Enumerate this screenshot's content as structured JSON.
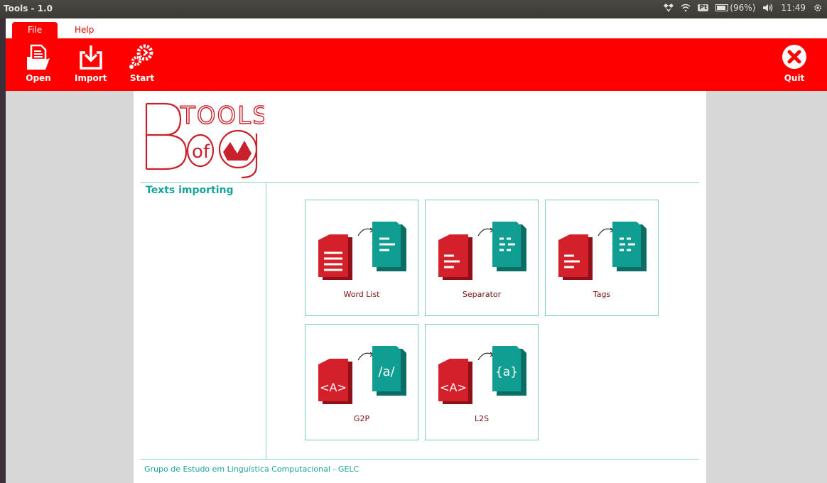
{
  "system_bar": {
    "window_title": "Tools - 1.0",
    "keyboard_layout": "Pt",
    "battery": "(96%)",
    "time": "11:49"
  },
  "menu": {
    "tabs": [
      {
        "label": "File",
        "active": true
      },
      {
        "label": "Help",
        "active": false
      }
    ]
  },
  "toolbar": {
    "open_label": "Open",
    "import_label": "Import",
    "start_label": "Start",
    "quit_label": "Quit"
  },
  "logo": {
    "line1": "TOOLS",
    "line2": "of",
    "line3": "Bag"
  },
  "main": {
    "section_title": "Texts importing",
    "tools": [
      {
        "label": "Word List",
        "icon": "document-to-document-icon",
        "glyph": ""
      },
      {
        "label": "Separator",
        "icon": "document-to-document-icon",
        "glyph": ""
      },
      {
        "label": "Tags",
        "icon": "document-to-document-icon",
        "glyph": ""
      },
      {
        "label": "G2P",
        "icon": "grapheme-to-phoneme-icon",
        "glyph": "/a/"
      },
      {
        "label": "L2S",
        "icon": "letter-to-sound-icon",
        "glyph": "{a}"
      }
    ]
  },
  "footer": {
    "text": "Grupo de Estudo em Linguística Computacional - GELC"
  },
  "colors": {
    "accent": "#fe0000",
    "teal": "#1aa59a",
    "doc_red": "#d4202a",
    "doc_teal": "#109d92"
  }
}
